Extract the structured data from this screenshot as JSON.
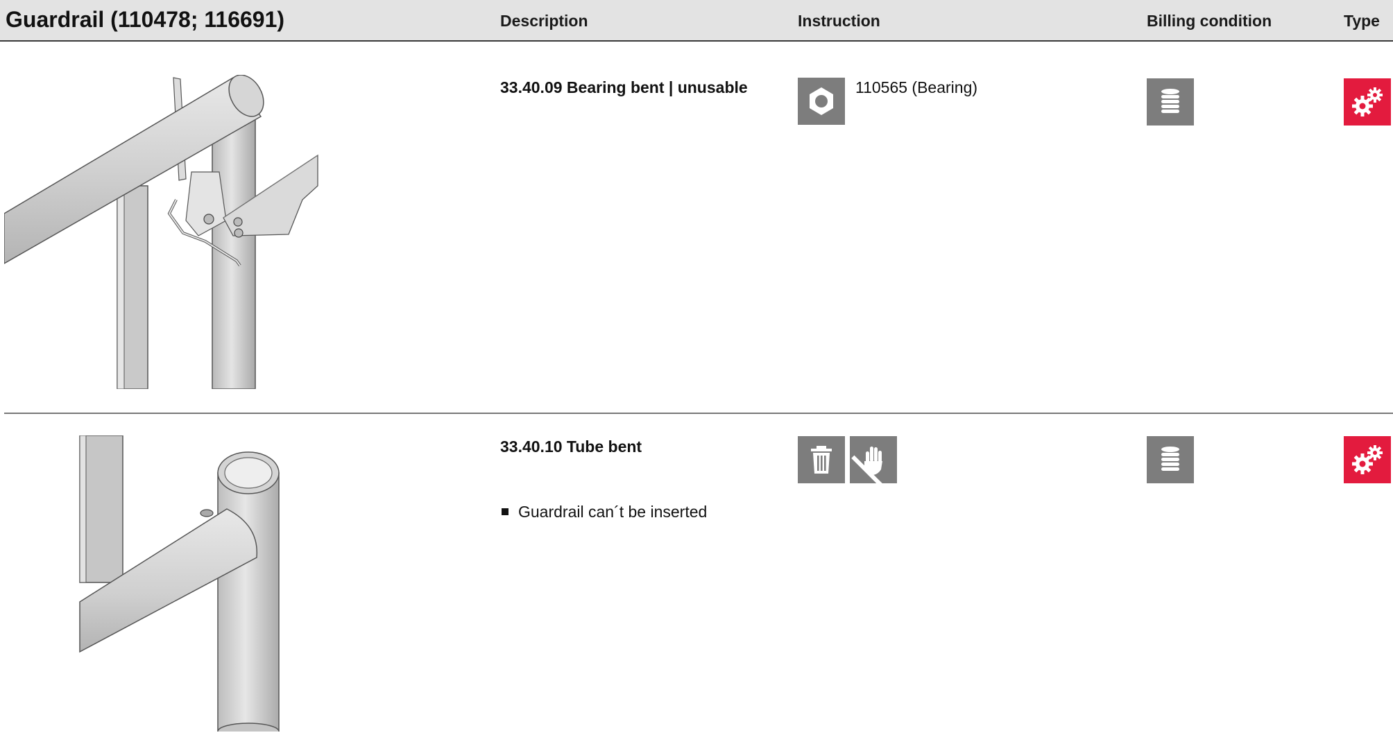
{
  "header": {
    "title": "Guardrail  (110478; 116691)",
    "description": "Description",
    "instruction": "Instruction",
    "billing_condition": "Billing condition",
    "type": "Type"
  },
  "rows": [
    {
      "code": "33.40.09 Bearing bent | unusable",
      "bullets": [],
      "instruction_icons": [
        "nut-icon"
      ],
      "instruction_text": "110565 (Bearing)",
      "billing_icon": "stack-icon",
      "type_icon": "gears-icon"
    },
    {
      "code": "33.40.10 Tube bent",
      "bullets": [
        "Guardrail can´t be inserted"
      ],
      "instruction_icons": [
        "trash-icon",
        "no-hand-icon"
      ],
      "instruction_text": "",
      "billing_icon": "stack-icon",
      "type_icon": "gears-icon"
    }
  ],
  "colors": {
    "header_bg": "#e3e3e3",
    "icon_gray": "#7d7d7d",
    "type_red": "#e31b3e"
  }
}
